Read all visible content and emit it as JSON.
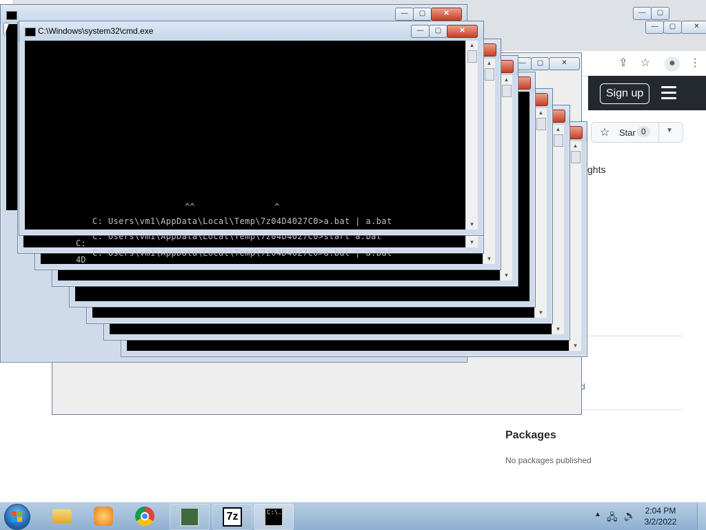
{
  "browser": {
    "signup_label": "Sign up",
    "star_label": "Star",
    "star_count": "0",
    "insights_fragment": "ghts",
    "packages_heading": "Packages",
    "packages_status": "No packages published",
    "fragment_d": "d"
  },
  "cmd": {
    "title": "C:\\Windows\\system32\\cmd.exe",
    "line_top": "C: Users\\vm1\\AppData\\Local\\Temp\\7z04D4027C0>a.bat | a.bat",
    "line_mid": "C: Users\\vm1\\AppData\\Local\\Temp\\7z04D4027C0>start a.bat",
    "line_bot": "C: Users\\vm1\\AppData\\Local\\Temp\\7z04D4027C0>a.bat | a.bat",
    "frag_4d": "4D",
    "frag_c": "C:",
    "frag_caret": "^^                ^",
    "frag_cmd_icon": "C:\\."
  },
  "taskbar": {
    "time": "2:04 PM",
    "date": "3/2/2022",
    "apps": [
      "start-button",
      "file-explorer",
      "media-player",
      "chrome",
      "task-manager",
      "7zip",
      "command-prompt"
    ]
  },
  "colors": {
    "console_bg": "#000000",
    "console_fg": "#c0c0c0",
    "chrome_frame": "#cfdbeb",
    "close_red": "#c73f26",
    "github_header": "#24292f",
    "taskbar": "#9dbad8"
  }
}
